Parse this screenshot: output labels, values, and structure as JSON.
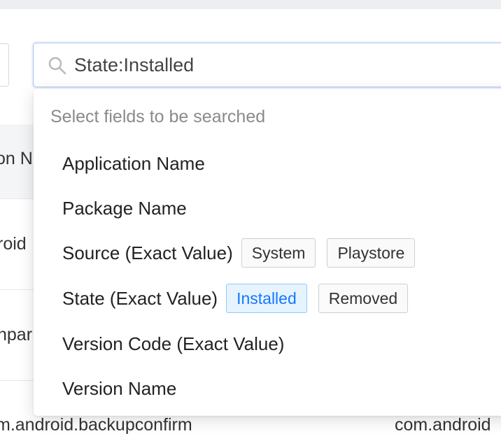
{
  "search": {
    "value": "State:Installed",
    "placeholder": ""
  },
  "dropdown": {
    "hint": "Select fields to be searched",
    "items": [
      {
        "label": "Application Name",
        "options": []
      },
      {
        "label": "Package Name",
        "options": []
      },
      {
        "label": "Source (Exact Value)",
        "options": [
          {
            "label": "System",
            "selected": false
          },
          {
            "label": "Playstore",
            "selected": false
          }
        ]
      },
      {
        "label": "State (Exact Value)",
        "options": [
          {
            "label": "Installed",
            "selected": true
          },
          {
            "label": "Removed",
            "selected": false
          }
        ]
      },
      {
        "label": "Version Code (Exact Value)",
        "options": []
      },
      {
        "label": "Version Name",
        "options": []
      }
    ]
  },
  "background": {
    "header_fragment": "on N",
    "row1_fragment": "roid",
    "row2_fragment": "npar",
    "row3_left": "m.android.backupconfirm",
    "row3_right": "com.android"
  },
  "colors": {
    "accent": "#1677ff",
    "selected_chip_bg": "#e6f4ff",
    "focus_border": "#a9c7ee"
  },
  "icons": {
    "search": "magnifier"
  }
}
